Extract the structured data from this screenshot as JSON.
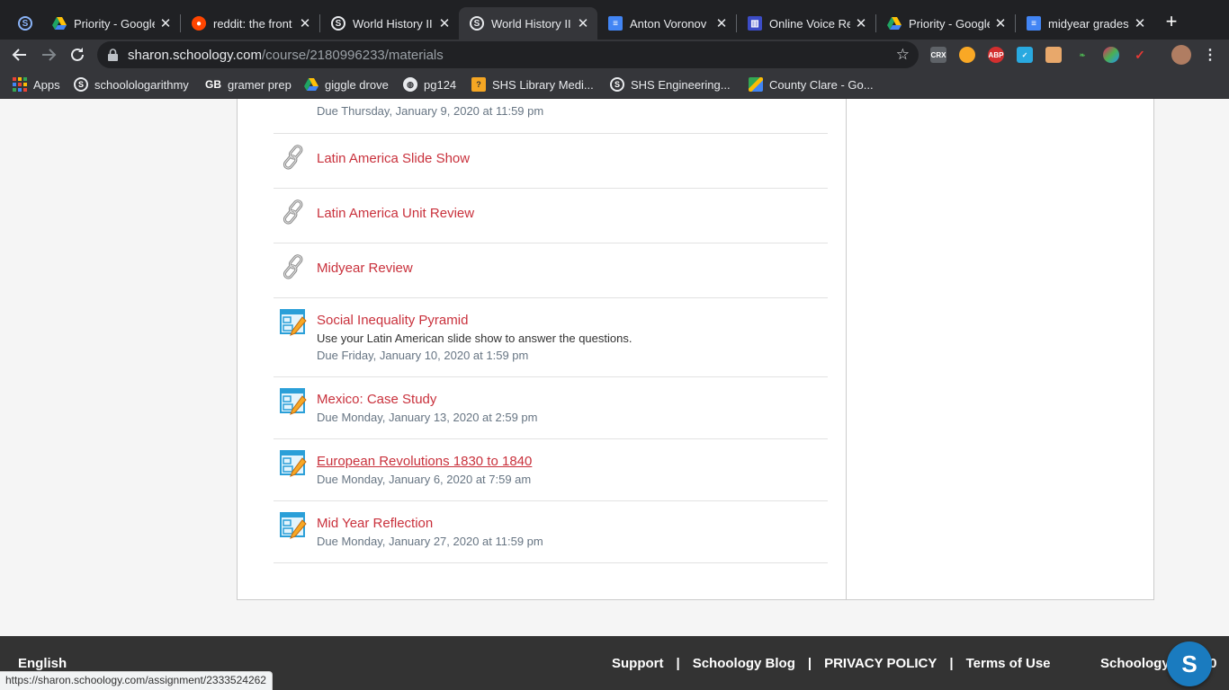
{
  "browser": {
    "tabs": [
      {
        "title": "",
        "icon": "schoology-icon",
        "color": "#202124"
      },
      {
        "title": "Priority - Google",
        "icon": "google-drive-icon",
        "color": "#1fa463"
      },
      {
        "title": "reddit: the front",
        "icon": "reddit-icon",
        "color": "#ff4500"
      },
      {
        "title": "World History II",
        "icon": "schoology-icon",
        "color": "#202124"
      },
      {
        "title": "World History II",
        "icon": "schoology-icon",
        "color": "#202124"
      },
      {
        "title": "Anton Voronov",
        "icon": "google-docs-icon",
        "color": "#4285f4"
      },
      {
        "title": "Online Voice Re",
        "icon": "voice-recorder-icon",
        "color": "#3c4cc6"
      },
      {
        "title": "Priority - Google",
        "icon": "google-drive-icon",
        "color": "#1fa463"
      },
      {
        "title": "midyear grades",
        "icon": "google-docs-icon",
        "color": "#4285f4"
      }
    ],
    "url_host": "sharon.schoology.com",
    "url_path": "/course/2180996233/materials",
    "bookmarks": [
      {
        "label": "Apps",
        "icon": "apps-grid-icon"
      },
      {
        "label": "schoolologarithmy",
        "icon": "schoology-icon"
      },
      {
        "label": "gramer prep",
        "icon": "gb-icon"
      },
      {
        "label": "giggle drove",
        "icon": "google-drive-icon"
      },
      {
        "label": "pg124",
        "icon": "globe-icon"
      },
      {
        "label": "SHS Library Medi...",
        "icon": "library-icon"
      },
      {
        "label": "SHS Engineering...",
        "icon": "schoology-icon"
      },
      {
        "label": "County Clare - Go...",
        "icon": "google-maps-icon"
      }
    ],
    "extensions": [
      "CRX",
      "",
      "ABP",
      "",
      "",
      "",
      "",
      ""
    ],
    "status_url": "https://sharon.schoology.com/assignment/2333524262"
  },
  "materials": {
    "top_due": "Due Thursday, January 9, 2020 at 11:59 pm",
    "items": [
      {
        "type": "link",
        "title": "Latin America Slide Show"
      },
      {
        "type": "link",
        "title": "Latin America Unit Review"
      },
      {
        "type": "link",
        "title": "Midyear Review"
      },
      {
        "type": "assignment",
        "title": "Social Inequality Pyramid",
        "description": "Use your Latin American slide show to answer the questions.",
        "due": "Due Friday, January 10, 2020 at 1:59 pm"
      },
      {
        "type": "assignment",
        "title": "Mexico: Case Study",
        "due": "Due Monday, January 13, 2020 at 2:59 pm"
      },
      {
        "type": "assignment",
        "title": "European Revolutions 1830 to 1840",
        "due": "Due Monday, January 6, 2020 at 7:59 am"
      },
      {
        "type": "assignment",
        "title": "Mid Year Reflection",
        "due": "Due Monday, January 27, 2020 at 11:59 pm"
      }
    ]
  },
  "footer": {
    "language": "English",
    "links": [
      "Support",
      "Schoology Blog",
      "PRIVACY POLICY",
      "Terms of Use"
    ],
    "separator": "|",
    "copyright": "Schoology © 2020",
    "badge": "S"
  },
  "colors": {
    "link_red": "#c9313c",
    "due_gray": "#677583",
    "footer_bg": "#333333",
    "badge_blue": "#1a7bbf"
  }
}
